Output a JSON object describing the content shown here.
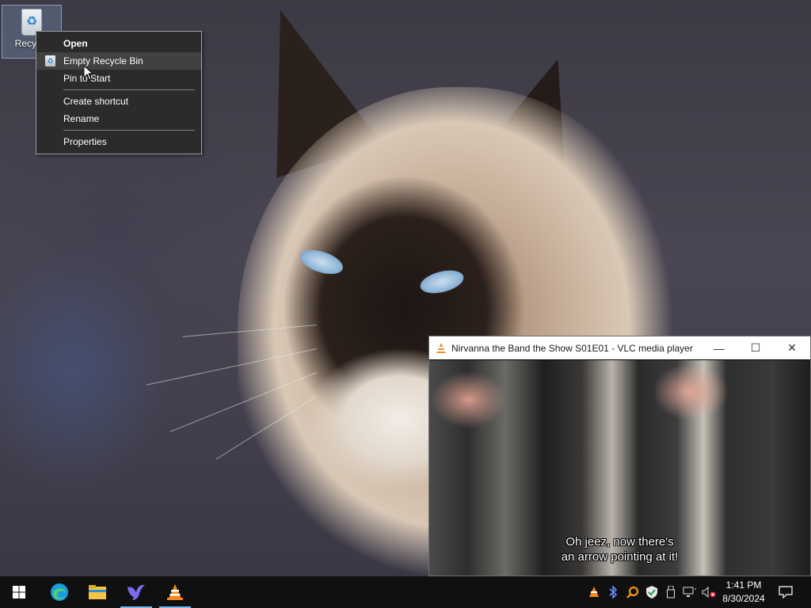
{
  "desktop": {
    "recycle_bin_label": "Recycle Bin",
    "visible_label": "Recycle"
  },
  "context_menu": {
    "items": [
      {
        "label": "Open",
        "bold": true
      },
      {
        "label": "Empty Recycle Bin",
        "hover": true,
        "icon": "recycle-bin-icon"
      },
      {
        "label": "Pin to Start"
      },
      {
        "label": "Create shortcut"
      },
      {
        "label": "Rename"
      },
      {
        "label": "Properties"
      }
    ]
  },
  "vlc": {
    "title": "Nirvanna the Band the Show S01E01 - VLC media player",
    "subtitle_line1": "Oh jeez, now there's",
    "subtitle_line2": "an arrow pointing at it!",
    "minimize_glyph": "—",
    "maximize_glyph": "☐",
    "close_glyph": "✕"
  },
  "taskbar": {
    "pinned": [
      "start-icon",
      "edge-icon",
      "file-explorer-icon",
      "bird-app-icon",
      "vlc-icon"
    ],
    "tray": [
      "vlc-tray-icon",
      "bluetooth-icon",
      "search-tray-icon",
      "defender-icon",
      "usb-icon",
      "network-icon",
      "volume-muted-icon"
    ],
    "time": "1:41 PM",
    "date": "8/30/2024"
  },
  "colors": {
    "menu_bg": "#2b2b2b",
    "menu_hover": "#414141",
    "taskbar_bg": "#101010",
    "active_underline": "#76b9ed",
    "vlc_orange": "#f58a1f"
  }
}
